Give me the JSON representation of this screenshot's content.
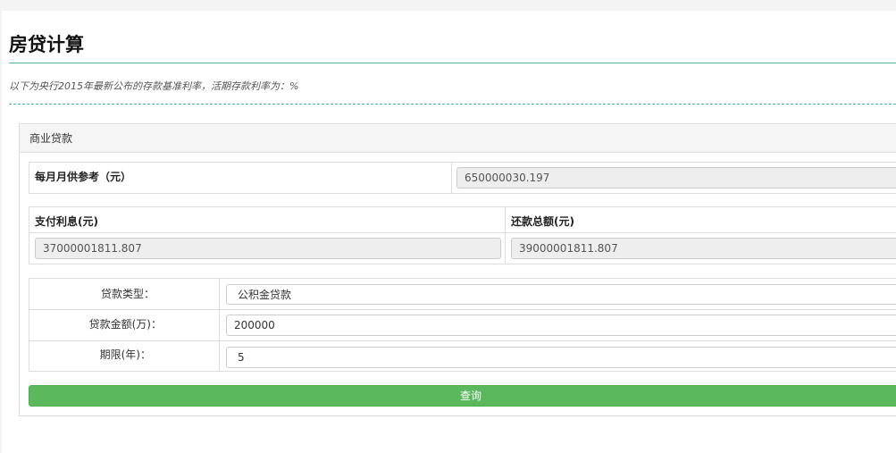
{
  "page": {
    "title": "房贷计算",
    "note": "以下为央行2015年最新公布的存款基准利率，活期存款利率为：%"
  },
  "panel": {
    "heading": "商业贷款",
    "monthly": {
      "label": "每月月供参考（元）",
      "value": "650000030.197"
    },
    "interest": {
      "label": "支付利息(元)",
      "value": "37000001811.807"
    },
    "total": {
      "label": "还款总额(元)",
      "value": "39000001811.807"
    },
    "form": {
      "loan_type_label": "贷款类型：",
      "loan_type_value": "公积金贷款",
      "amount_label": "贷款金额(万)：",
      "amount_value": "200000",
      "term_label": "期限(年)：",
      "term_value": "5"
    },
    "query_button": "查询"
  }
}
